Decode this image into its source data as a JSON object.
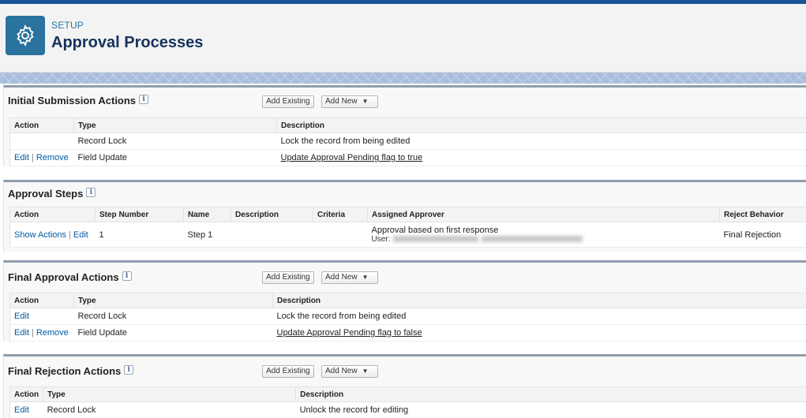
{
  "header": {
    "subtitle": "SETUP",
    "title": "Approval Processes",
    "icon": "gear-icon"
  },
  "buttons": {
    "add_existing": "Add Existing",
    "add_new": "Add New",
    "add_new_caret": "▼"
  },
  "info_icon_glyph": "i",
  "initial_submission": {
    "title": "Initial Submission Actions",
    "columns": [
      "Action",
      "Type",
      "Description"
    ],
    "rows": [
      {
        "edit": "",
        "remove": "",
        "type": "Record Lock",
        "description": "Lock the record from being edited"
      },
      {
        "edit": "Edit",
        "remove": "Remove",
        "type": "Field Update",
        "description": "Update Approval Pending flag to true"
      }
    ]
  },
  "approval_steps": {
    "title": "Approval Steps",
    "columns": [
      "Action",
      "Step Number",
      "Name",
      "Description",
      "Criteria",
      "Assigned Approver",
      "Reject Behavior"
    ],
    "rows": [
      {
        "show_actions": "Show Actions",
        "edit": "Edit",
        "step_number": "1",
        "name": "Step 1",
        "description": "",
        "criteria": "",
        "approver": "Approval based on first response",
        "approver_user_label": "User:",
        "reject_behavior": "Final Rejection"
      }
    ]
  },
  "final_approval": {
    "title": "Final Approval Actions",
    "columns": [
      "Action",
      "Type",
      "Description"
    ],
    "rows": [
      {
        "edit": "Edit",
        "remove": "",
        "type": "Record Lock",
        "description": "Lock the record from being edited"
      },
      {
        "edit": "Edit",
        "remove": "Remove",
        "type": "Field Update",
        "description": "Update Approval Pending flag to false"
      }
    ]
  },
  "final_rejection": {
    "title": "Final Rejection Actions",
    "columns": [
      "Action",
      "Type",
      "Description"
    ],
    "rows": [
      {
        "edit": "Edit",
        "type": "Record Lock",
        "description": "Unlock the record for editing"
      }
    ]
  }
}
